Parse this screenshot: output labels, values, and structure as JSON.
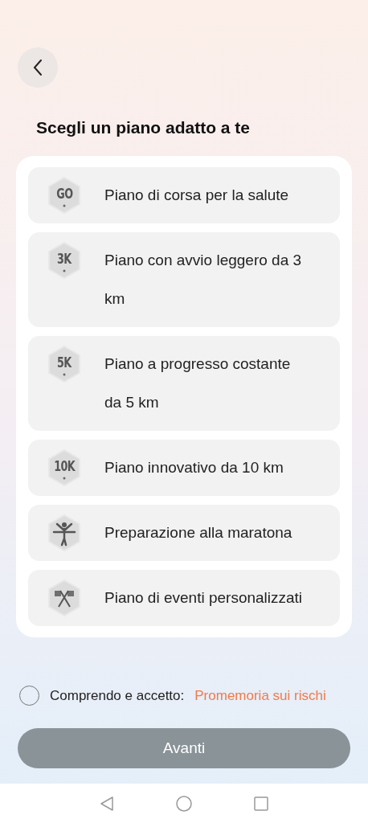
{
  "title": "Scegli un piano adatto a te",
  "plans": [
    {
      "kind": "badge",
      "badge": "GO",
      "lines": [
        "Piano di corsa per la salute"
      ]
    },
    {
      "kind": "badge",
      "badge": "3K",
      "lines": [
        "Piano con avvio leggero da 3",
        "km"
      ]
    },
    {
      "kind": "badge",
      "badge": "5K",
      "lines": [
        "Piano a progresso costante",
        "da 5 km"
      ]
    },
    {
      "kind": "badge",
      "badge": "10K",
      "lines": [
        "Piano innovativo da 10 km"
      ]
    },
    {
      "kind": "runner",
      "lines": [
        "Preparazione alla maratona"
      ]
    },
    {
      "kind": "flags",
      "lines": [
        "Piano di eventi personalizzati"
      ]
    }
  ],
  "consent": {
    "checked": false,
    "label": "Comprendo e accetto:",
    "link": "Promemoria sui rischi"
  },
  "next_button": {
    "label": "Avanti",
    "disabled": true
  }
}
